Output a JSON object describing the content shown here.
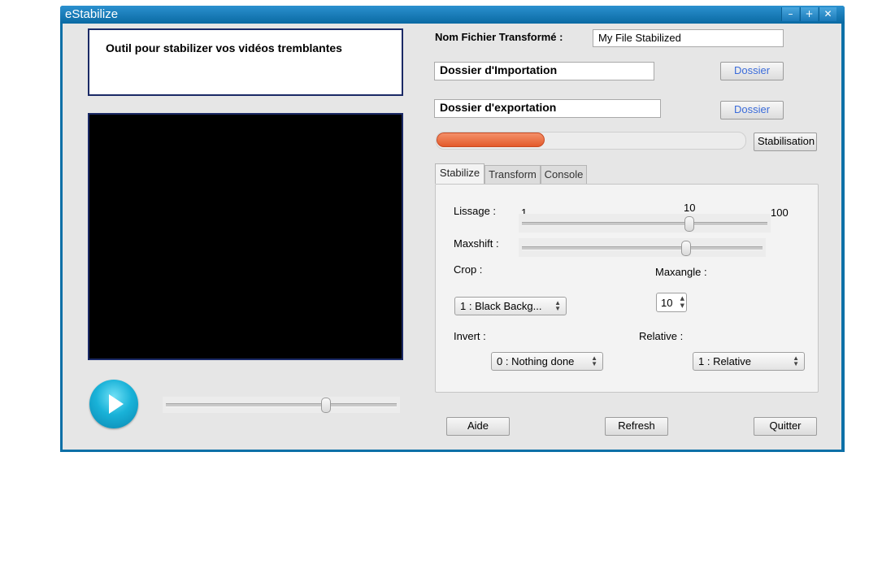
{
  "window": {
    "title": "eStabilize",
    "controls": {
      "minimize": "–",
      "maximize": "+",
      "close": "✕"
    }
  },
  "description": "Outil pour stabilizer vos vidéos tremblantes",
  "player": {
    "play_icon": "play-icon",
    "position": 0.69
  },
  "output_name": {
    "label": "Nom Fichier Transformé :",
    "value": "My File Stabilized"
  },
  "import_folder": {
    "value": "Dossier d'Importation",
    "button": "Dossier"
  },
  "export_folder": {
    "value": "Dossier d'exportation",
    "button": "Dossier"
  },
  "progress": {
    "fraction": 0.35,
    "button": "Stabilisation"
  },
  "tabs": [
    {
      "label": "Stabilize",
      "active": true
    },
    {
      "label": "Transform",
      "active": false
    },
    {
      "label": "Console",
      "active": false
    }
  ],
  "stabilize": {
    "lissage": {
      "label": "Lissage :",
      "min": "1",
      "value": "10",
      "max": "100",
      "fraction": 0.68
    },
    "maxshift": {
      "label": "Maxshift :",
      "fraction": 0.68
    },
    "crop": {
      "label": "Crop :",
      "selected": "1 : Black Backg..."
    },
    "maxangle": {
      "label": "Maxangle :",
      "value": "10"
    },
    "invert": {
      "label": "Invert :",
      "selected": "0 : Nothing done"
    },
    "relative": {
      "label": "Relative :",
      "selected": "1 : Relative"
    }
  },
  "footer": {
    "help": "Aide",
    "refresh": "Refresh",
    "quit": "Quitter"
  },
  "colors": {
    "titlebar": "#0a6aa3",
    "accent_progress": "#e45a2b",
    "play": "#19b2d8"
  }
}
